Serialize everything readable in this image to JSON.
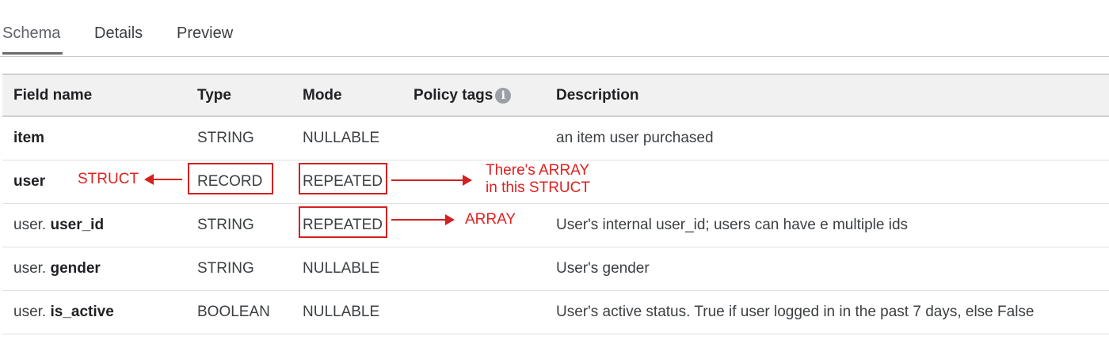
{
  "tabs": [
    {
      "label": "Schema"
    },
    {
      "label": "Details"
    },
    {
      "label": "Preview"
    }
  ],
  "table": {
    "headers": {
      "field": "Field name",
      "type": "Type",
      "mode": "Mode",
      "policy": "Policy tags",
      "policy_icon": "info-icon",
      "description": "Description"
    },
    "rows": [
      {
        "prefix": "",
        "name": "item",
        "type": "STRING",
        "mode": "NULLABLE",
        "description": "an item user purchased"
      },
      {
        "prefix": "",
        "name": "user",
        "type": "RECORD",
        "mode": "REPEATED",
        "description": ""
      },
      {
        "prefix": "user. ",
        "name": "user_id",
        "type": "STRING",
        "mode": "REPEATED",
        "description": "User's internal user_id; users can have e multiple ids"
      },
      {
        "prefix": "user. ",
        "name": "gender",
        "type": "STRING",
        "mode": "NULLABLE",
        "description": "User's gender"
      },
      {
        "prefix": "user. ",
        "name": "is_active",
        "type": "BOOLEAN",
        "mode": "NULLABLE",
        "description": "User's active status. True if user logged in in the past 7 days, else False"
      }
    ]
  },
  "annotations": {
    "struct": "STRUCT",
    "array_in_struct_line1": "There's ARRAY",
    "array_in_struct_line2": "in this STRUCT",
    "array": "ARRAY",
    "color": "#d32020"
  }
}
